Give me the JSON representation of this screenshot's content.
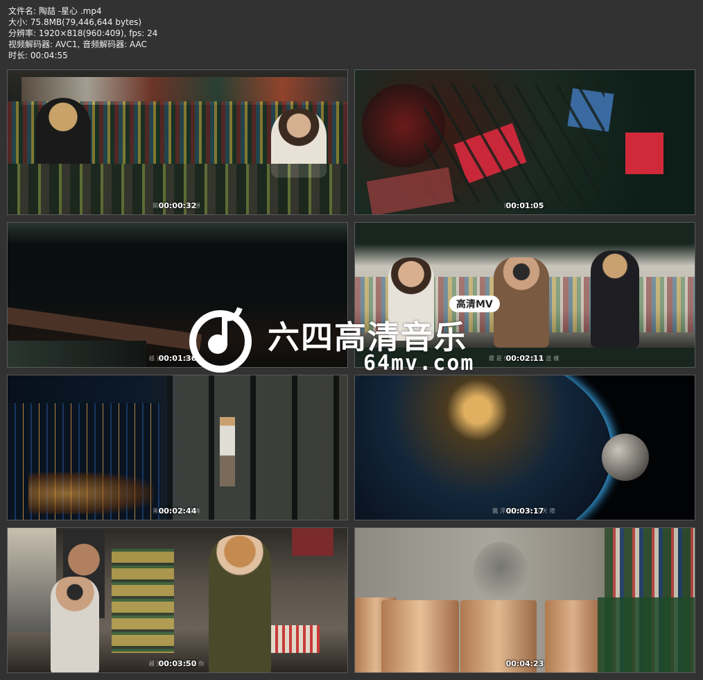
{
  "file_info": {
    "filename": "文件名: 陶喆 -星心  .mp4",
    "size": "大小: 75.8MB(79,446,644 bytes)",
    "resolution": "分辨率: 1920×818(960:409), fps: 24",
    "codecs": "视频解码器: AVC1, 音频解码器: AAC",
    "duration": "时长: 00:04:55"
  },
  "thumbnails": [
    {
      "timestamp": "00:00:32",
      "subtitle": "間自己    麼幻想"
    },
    {
      "timestamp": "00:01:05",
      "subtitle": "把你      的心中"
    },
    {
      "timestamp": "00:01:36",
      "subtitle": "越過了時      中廢一"
    },
    {
      "timestamp": "00:02:11",
      "subtitle": "還是你      一直都是這樣"
    },
    {
      "timestamp": "00:02:44",
      "subtitle": "黑暗中      我問亮"
    },
    {
      "timestamp": "00:03:17",
      "subtitle": "飄浮愛情      美的天際"
    },
    {
      "timestamp": "00:03:50",
      "subtitle": "越愛時      永遠是你"
    },
    {
      "timestamp": "00:04:23",
      "subtitle": ""
    }
  ],
  "watermark": {
    "title": "六四高清音乐",
    "badge": "高清MV",
    "url": "64mv.com"
  }
}
